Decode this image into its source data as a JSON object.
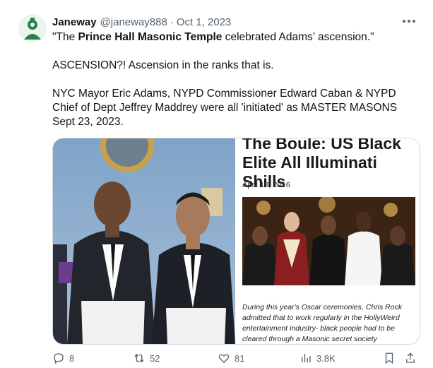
{
  "author": {
    "name": "Janeway",
    "handle": "@janeway888",
    "separator": "·",
    "date": "Oct 1, 2023"
  },
  "tweet": {
    "line1_pre": "\"The ",
    "line1_bold": "Prince Hall Masonic Temple",
    "line1_post": " celebrated Adams’ ascension.\"",
    "para2": "ASCENSION?! Ascension in the ranks that is.",
    "para3": "NYC Mayor Eric Adams, NYPD Commissioner Edward Caban & NYPD Chief of Dept Jeffrey Maddrey were all 'initiated' as MASTER MASONS Sept 23, 2023."
  },
  "article": {
    "title": "The Boule: US Black Elite All Illuminati Shills",
    "date": "April 18, 2016",
    "body": "During this year's Oscar ceremonies, Chris Rock admitted that to work regularly in the HollyWeird entertainment industry- black people had to be cleared through a Masonic secret society"
  },
  "actions": {
    "replies": "8",
    "reposts": "52",
    "likes": "81",
    "views": "3.8K"
  },
  "icons": {
    "more": "more-icon",
    "reply": "reply-icon",
    "repost": "repost-icon",
    "like": "like-icon",
    "views": "views-icon",
    "bookmark": "bookmark-icon",
    "share": "share-icon"
  },
  "colors": {
    "text": "#0f1419",
    "muted": "#536471",
    "border": "#cfd9de"
  }
}
